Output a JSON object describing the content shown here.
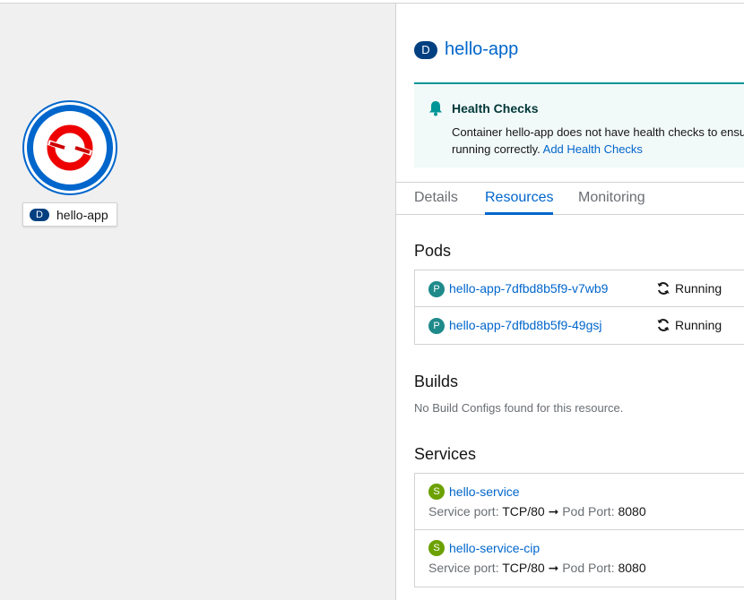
{
  "canvas": {
    "node": {
      "badge": "D",
      "label": "hello-app"
    }
  },
  "panel": {
    "badge": "D",
    "title": "hello-app",
    "alert": {
      "title": "Health Checks",
      "line1": "Container hello-app does not have health checks to ensu",
      "line2_prefix": "running correctly.",
      "link": "Add Health Checks"
    },
    "tabs": [
      {
        "label": "Details"
      },
      {
        "label": "Resources"
      },
      {
        "label": "Monitoring"
      }
    ],
    "pods": {
      "title": "Pods",
      "items": [
        {
          "badge": "P",
          "name": "hello-app-7dfbd8b5f9-v7wb9",
          "status": "Running"
        },
        {
          "badge": "P",
          "name": "hello-app-7dfbd8b5f9-49gsj",
          "status": "Running"
        }
      ]
    },
    "builds": {
      "title": "Builds",
      "empty": "No Build Configs found for this resource."
    },
    "services": {
      "title": "Services",
      "service_port_label": "Service port:",
      "pod_port_label": "Pod Port:",
      "items": [
        {
          "badge": "S",
          "name": "hello-service",
          "service_port": "TCP/80",
          "pod_port": "8080"
        },
        {
          "badge": "S",
          "name": "hello-service-cip",
          "service_port": "TCP/80",
          "pod_port": "8080"
        }
      ]
    }
  },
  "colors": {
    "link": "#0066cc",
    "deployment_badge": "#004080",
    "pod_badge": "#1f8a8a",
    "service_badge": "#6ca100",
    "alert_accent": "#009596"
  }
}
